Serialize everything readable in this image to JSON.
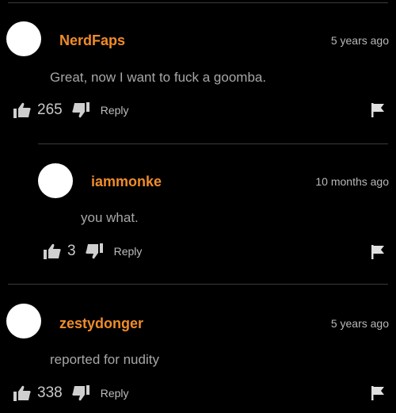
{
  "colors": {
    "background": "#000000",
    "username": "#f08c2a",
    "text": "#a7a7a7",
    "divider": "#3a3a3a"
  },
  "comments": [
    {
      "username": "NerdFaps",
      "time": "5 years ago",
      "text": "Great, now I want to fuck a goomba.",
      "likes": "265",
      "reply_label": "Reply"
    },
    {
      "username": "iammonke",
      "time": "10 months ago",
      "text": "you what.",
      "likes": "3",
      "reply_label": "Reply"
    },
    {
      "username": "zestydonger",
      "time": "5 years ago",
      "text": "reported for nudity",
      "likes": "338",
      "reply_label": "Reply"
    }
  ],
  "icons": {
    "like": "thumbs-up-icon",
    "dislike": "thumbs-down-icon",
    "flag": "flag-icon",
    "avatar": "avatar"
  }
}
